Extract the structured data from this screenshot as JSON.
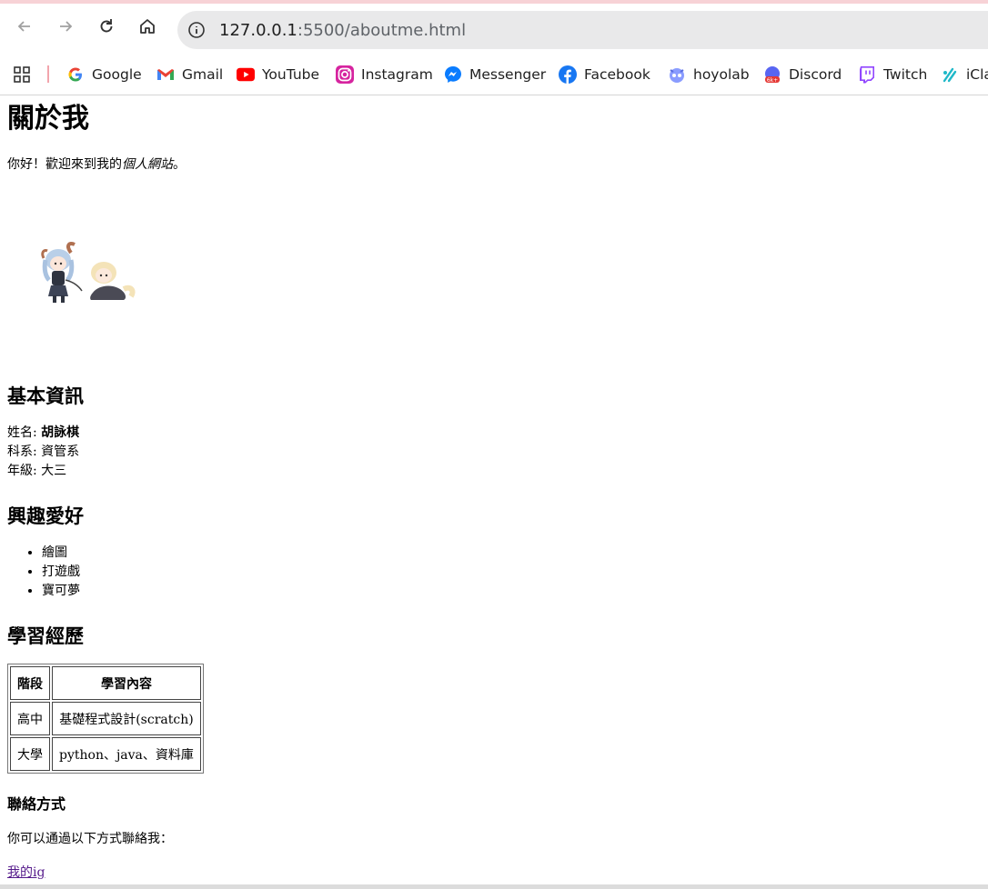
{
  "browser": {
    "url_host": "127.0.0.1",
    "url_rest": ":5500/aboutme.html",
    "bookmarks": [
      {
        "label": "Google",
        "icon": "google-icon"
      },
      {
        "label": "Gmail",
        "icon": "gmail-icon"
      },
      {
        "label": "YouTube",
        "icon": "youtube-icon"
      },
      {
        "label": "Instagram",
        "icon": "instagram-icon"
      },
      {
        "label": "Messenger",
        "icon": "messenger-icon"
      },
      {
        "label": "Facebook",
        "icon": "facebook-icon"
      },
      {
        "label": "hoyolab",
        "icon": "hoyolab-icon"
      },
      {
        "label": "Discord",
        "icon": "discord-icon"
      },
      {
        "label": "Twitch",
        "icon": "twitch-icon"
      },
      {
        "label": "iCla",
        "icon": "iclass-icon"
      }
    ]
  },
  "page": {
    "title": "關於我",
    "intro_prefix": "你好！歡迎來到我的",
    "intro_emph": "個人網站",
    "intro_suffix": "。",
    "basic": {
      "heading": "基本資訊",
      "name_label": "姓名: ",
      "name_value": "胡詠棋",
      "dept_label": "科系: ",
      "dept_value": "資管系",
      "grade_label": "年級: ",
      "grade_value": "大三"
    },
    "hobbies": {
      "heading": "興趣愛好",
      "items": [
        "繪圖",
        "打遊戲",
        "寶可夢"
      ]
    },
    "history": {
      "heading": "學習經歷",
      "headers": [
        "階段",
        "學習內容"
      ],
      "rows": [
        [
          "高中",
          "基礎程式設計(scratch)"
        ],
        [
          "大學",
          "python、java、資料庫"
        ]
      ]
    },
    "contact": {
      "heading": "聯絡方式",
      "text": "你可以通過以下方式聯絡我：",
      "link": "我的ig"
    }
  }
}
